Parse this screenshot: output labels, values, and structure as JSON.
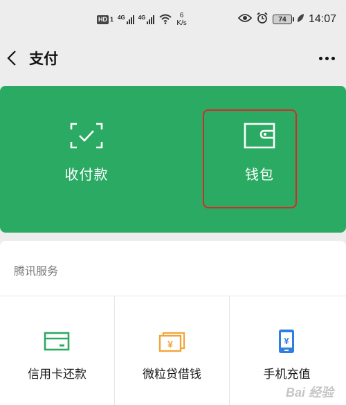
{
  "status_bar": {
    "hd_label": "HD",
    "hd_sim": "1",
    "network_1": "4G",
    "network_2": "4G",
    "speed_value": "6",
    "speed_unit": "K/s",
    "battery": "74",
    "time": "14:07"
  },
  "nav": {
    "title": "支付",
    "back_icon": "chevron-left-icon",
    "more_icon": "more-dots-icon"
  },
  "payment_card": {
    "color": "#2aaa63",
    "items": [
      {
        "label": "收付款",
        "icon": "scan-receive-icon"
      },
      {
        "label": "钱包",
        "icon": "wallet-icon"
      }
    ]
  },
  "services": {
    "section_title": "腾讯服务",
    "items": [
      {
        "label": "信用卡还款",
        "icon": "credit-card-icon",
        "color": "#2aaa63"
      },
      {
        "label": "微粒贷借钱",
        "icon": "loan-icon",
        "color": "#f0a53a"
      },
      {
        "label": "手机充值",
        "icon": "phone-recharge-icon",
        "color": "#2f7fe0"
      }
    ]
  },
  "watermark": "Bai 经验"
}
